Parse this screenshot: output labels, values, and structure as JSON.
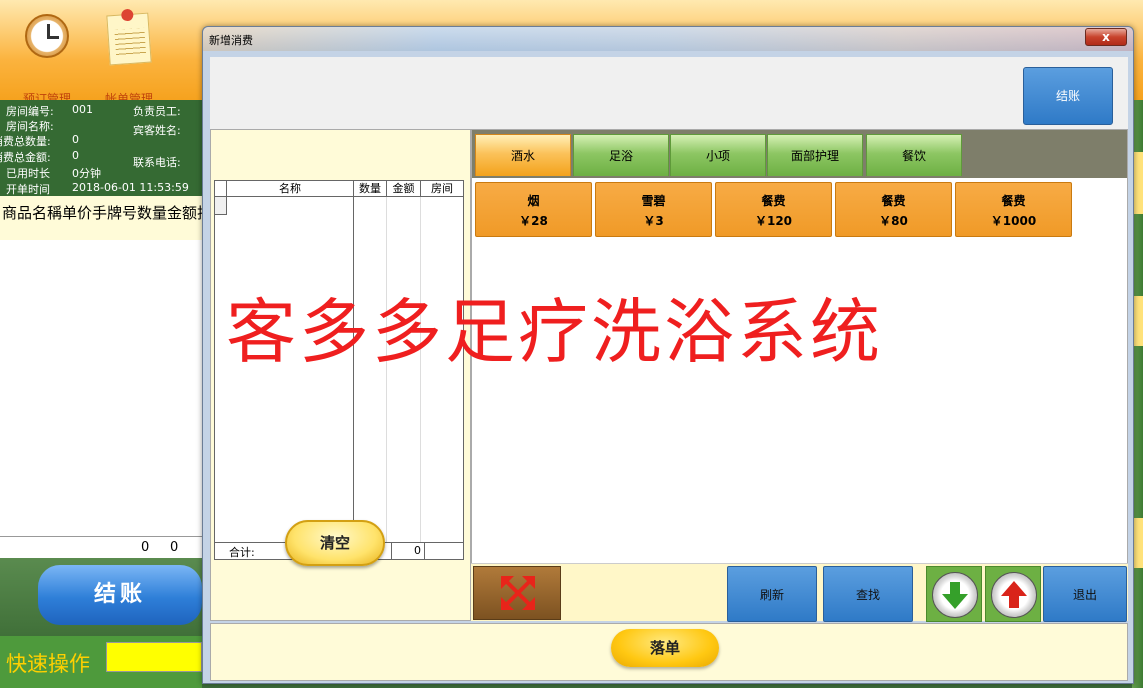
{
  "background_app": {
    "toolbar": [
      {
        "label": "预订管理",
        "icon": "clock-icon"
      },
      {
        "label": "帐单管理",
        "icon": "memo-icon"
      }
    ],
    "room_info": {
      "room_no_label": "房间编号:",
      "room_no": "001",
      "room_name_label": "房间名称:",
      "qty_total_label": "消费总数量:",
      "qty_total": "0",
      "amount_total_label": "消费总金额:",
      "amount_total": "0",
      "time_used_label": "已用时长",
      "time_used": "0分钟",
      "open_time_label": "开单时间",
      "open_time": "2018-06-01 11:53:59",
      "staff_label": "负责员工:",
      "guest_label": "宾客姓名:",
      "phone_label": "联系电话:"
    },
    "list_header": "商品名稱单价手牌号数量金额技",
    "list_totals": [
      "0",
      "0"
    ],
    "checkout_button": "结账",
    "quick_action_label": "快速操作"
  },
  "dialog": {
    "title": "新增消费",
    "close_label": "x",
    "top_checkout_button": "结账",
    "grid": {
      "columns": [
        "名称",
        "数量",
        "金额",
        "房间"
      ],
      "total_label": "合计:",
      "total_value": "0"
    },
    "clear_button": "清空",
    "categories": [
      {
        "label": "酒水",
        "active": true
      },
      {
        "label": "足浴",
        "active": false
      },
      {
        "label": "小项",
        "active": false
      },
      {
        "label": "面部护理",
        "active": false
      },
      {
        "label": "餐饮",
        "active": false
      }
    ],
    "items": [
      {
        "name": "烟",
        "price": "￥28"
      },
      {
        "name": "雪碧",
        "price": "￥3"
      },
      {
        "name": "餐费",
        "price": "￥120"
      },
      {
        "name": "餐费",
        "price": "￥80"
      },
      {
        "name": "餐费",
        "price": "￥1000"
      }
    ],
    "watermark": "客多多足疗洗浴系统",
    "bottom_buttons": {
      "refresh": "刷新",
      "find": "查找",
      "exit": "退出"
    },
    "submit_button": "落单"
  },
  "colors": {
    "accent_orange": "#f09a27",
    "tab_green": "#6db043",
    "button_blue": "#2f7ac7",
    "watermark_red": "#ef1f1f"
  }
}
